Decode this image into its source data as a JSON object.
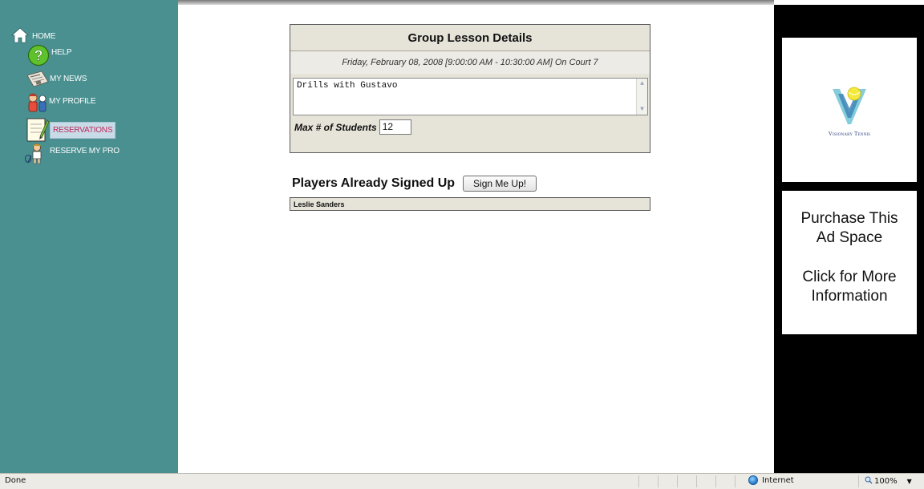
{
  "nav": {
    "items": [
      {
        "label": "HOME",
        "icon": "home-icon"
      },
      {
        "label": "HELP",
        "icon": "help-icon"
      },
      {
        "label": "MY NEWS",
        "icon": "newspaper-icon"
      },
      {
        "label": "MY PROFILE",
        "icon": "profile-icon"
      },
      {
        "label": "RESERVATIONS",
        "icon": "notepad-icon",
        "active": true
      },
      {
        "label": "RESERVE MY PRO",
        "icon": "tennis-pro-icon"
      }
    ]
  },
  "lesson": {
    "title": "Group Lesson Details",
    "datetime": "Friday, February 08, 2008 [9:00:00 AM - 10:30:00 AM] On Court 7",
    "notes": "Drills with Gustavo",
    "max_label": "Max # of Students",
    "max_value": "12"
  },
  "players": {
    "heading": "Players Already Signed Up",
    "signup_label": "Sign Me Up!",
    "rows": [
      "Leslie Sanders"
    ]
  },
  "ads": {
    "brand": "Visionary Tennis",
    "purchase_line1": "Purchase This",
    "purchase_line2": "Ad Space",
    "purchase_line3": "Click for More",
    "purchase_line4": "Information"
  },
  "statusbar": {
    "status": "Done",
    "zone": "Internet",
    "zoom": "100%"
  },
  "colors": {
    "sidebar": "#4a9090",
    "panel": "#e6e3d8",
    "active_label": "#c0265a",
    "ad_background": "#000000"
  }
}
